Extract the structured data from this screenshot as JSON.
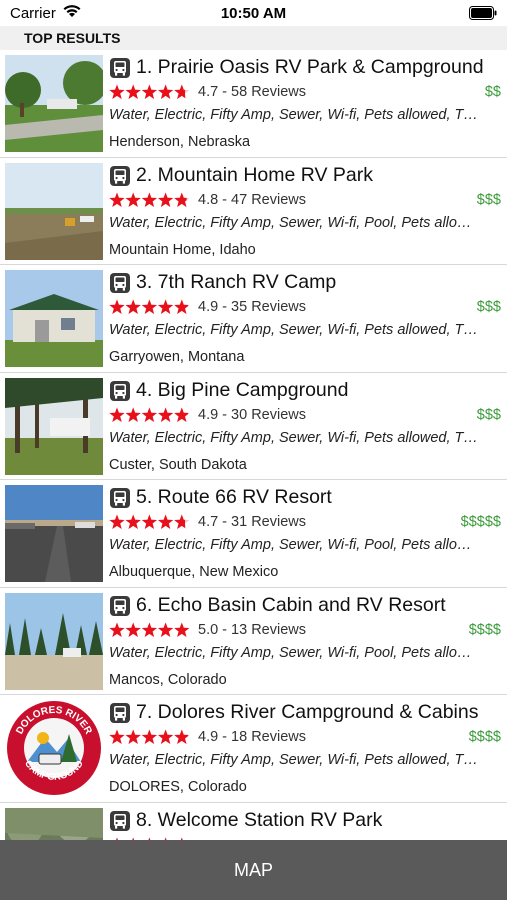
{
  "status_bar": {
    "carrier": "Carrier",
    "time": "10:50 AM",
    "icons": [
      "wifi-icon",
      "battery-icon"
    ]
  },
  "section": {
    "title": "TOP RESULTS"
  },
  "colors": {
    "star": "#e8101a",
    "price": "#3a9a3a",
    "map_bar": "#5a5a5a"
  },
  "results": [
    {
      "title": "1. Prairie Oasis RV Park & Campground",
      "score": "4.7 - 58 Reviews",
      "stars": 4.7,
      "price": "$$",
      "amenities": "Water, Electric, Fifty Amp, Sewer, Wi-fi, Pets allowed, T…",
      "location": "Henderson, Nebraska",
      "thumb": "trees-lawn"
    },
    {
      "title": "2. Mountain Home RV Park",
      "score": "4.8 - 47 Reviews",
      "stars": 4.8,
      "price": "$$$",
      "amenities": "Water, Electric, Fifty Amp, Sewer, Wi-fi, Pool, Pets allo…",
      "location": "Mountain Home, Idaho",
      "thumb": "open-field"
    },
    {
      "title": "3. 7th Ranch RV Camp",
      "score": "4.9 - 35 Reviews",
      "stars": 4.9,
      "price": "$$$",
      "amenities": "Water, Electric, Fifty Amp, Sewer, Wi-fi, Pets allowed, T…",
      "location": "Garryowen, Montana",
      "thumb": "building"
    },
    {
      "title": "4. Big Pine Campground",
      "score": "4.9 - 30 Reviews",
      "stars": 4.9,
      "price": "$$$",
      "amenities": "Water, Electric, Fifty Amp, Sewer, Wi-fi, Pets allowed, T…",
      "location": "Custer, South Dakota",
      "thumb": "pines"
    },
    {
      "title": "5. Route 66 RV Resort",
      "score": "4.7 - 31 Reviews",
      "stars": 4.7,
      "price": "$$$$$",
      "amenities": "Water, Electric, Fifty Amp, Sewer, Wi-fi, Pool, Pets allo…",
      "location": "Albuquerque, New Mexico",
      "thumb": "road"
    },
    {
      "title": "6. Echo Basin Cabin and RV Resort",
      "score": "5.0 - 13 Reviews",
      "stars": 5.0,
      "price": "$$$$",
      "amenities": "Water, Electric, Fifty Amp, Sewer, Wi-fi, Pool, Pets allo…",
      "location": "Mancos, Colorado",
      "thumb": "forest"
    },
    {
      "title": "7. Dolores River Campground & Cabins",
      "score": "4.9 - 18 Reviews",
      "stars": 4.9,
      "price": "$$$$",
      "amenities": "Water, Electric, Fifty Amp, Sewer, Wi-fi, Pets allowed, T…",
      "location": "DOLORES, Colorado",
      "thumb": "logo",
      "logo_text_top": "DOLORES RIVER",
      "logo_text_bottom": "CAMPGROUND"
    },
    {
      "title": "8. Welcome Station RV Park",
      "score": "",
      "stars": 5.0,
      "price": "",
      "amenities": "",
      "location": "",
      "thumb": "rocks"
    }
  ],
  "map_button": {
    "label": "MAP"
  }
}
